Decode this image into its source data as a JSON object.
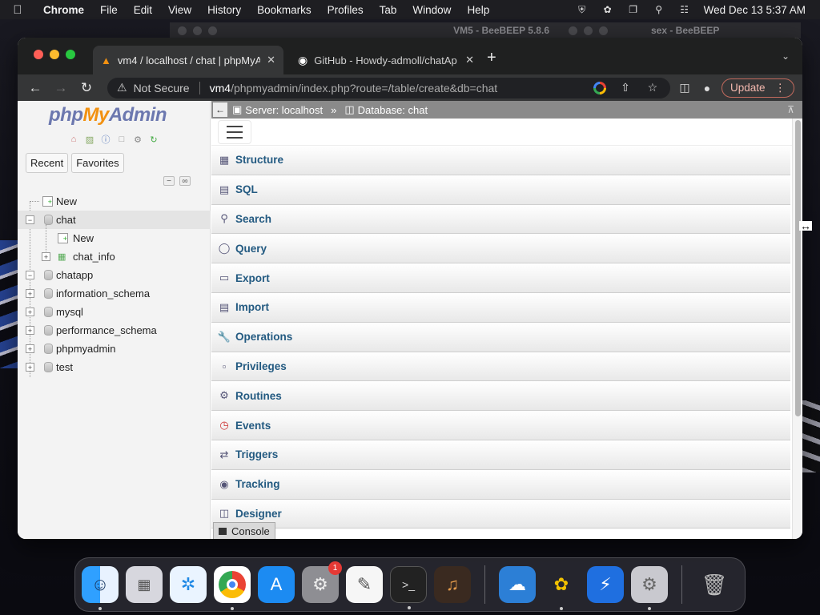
{
  "menubar": {
    "app_name": "Chrome",
    "items": [
      "File",
      "Edit",
      "View",
      "History",
      "Bookmarks",
      "Profiles",
      "Tab",
      "Window",
      "Help"
    ],
    "clock": "Wed Dec 13  5:37 AM"
  },
  "background_windows": [
    {
      "title": "VM5 - BeeBEEP 5.8.6"
    },
    {
      "title": "sex - BeeBEEP"
    }
  ],
  "browser": {
    "tabs": [
      {
        "title": "vm4 / localhost / chat | phpMyA",
        "active": true
      },
      {
        "title": "GitHub - Howdy-admoll/chatAp",
        "active": false
      }
    ],
    "address": {
      "security_label": "Not Secure",
      "host": "vm4",
      "path": "/phpmyadmin/index.php?route=/table/create&db=chat"
    },
    "update_label": "Update"
  },
  "pma": {
    "logo": {
      "php": "php",
      "my": "My",
      "admin": "Admin"
    },
    "side_tabs": [
      "Recent",
      "Favorites"
    ],
    "tree": [
      {
        "label": "New",
        "level": 0,
        "kind": "new"
      },
      {
        "label": "chat",
        "level": 0,
        "kind": "db",
        "expanded": true
      },
      {
        "label": "New",
        "level": 1,
        "kind": "new"
      },
      {
        "label": "chat_info",
        "level": 1,
        "kind": "table"
      },
      {
        "label": "chatapp",
        "level": 0,
        "kind": "db",
        "expanded": true
      },
      {
        "label": "information_schema",
        "level": 0,
        "kind": "db"
      },
      {
        "label": "mysql",
        "level": 0,
        "kind": "db"
      },
      {
        "label": "performance_schema",
        "level": 0,
        "kind": "db"
      },
      {
        "label": "phpmyadmin",
        "level": 0,
        "kind": "db"
      },
      {
        "label": "test",
        "level": 0,
        "kind": "db"
      }
    ],
    "breadcrumb": {
      "server": "Server: localhost",
      "sep": "»",
      "database": "Database: chat"
    },
    "menu": [
      {
        "label": "Structure",
        "icon": "structure-icon"
      },
      {
        "label": "SQL",
        "icon": "sql-icon"
      },
      {
        "label": "Search",
        "icon": "search-icon"
      },
      {
        "label": "Query",
        "icon": "query-icon"
      },
      {
        "label": "Export",
        "icon": "export-icon"
      },
      {
        "label": "Import",
        "icon": "import-icon"
      },
      {
        "label": "Operations",
        "icon": "wrench-icon"
      },
      {
        "label": "Privileges",
        "icon": "privileges-icon"
      },
      {
        "label": "Routines",
        "icon": "routines-icon"
      },
      {
        "label": "Events",
        "icon": "clock-icon"
      },
      {
        "label": "Triggers",
        "icon": "triggers-icon"
      },
      {
        "label": "Tracking",
        "icon": "eye-icon"
      },
      {
        "label": "Designer",
        "icon": "designer-icon"
      }
    ],
    "console_label": "Console"
  },
  "dock": {
    "apps": [
      "Finder",
      "Launchpad",
      "Safari",
      "Chrome",
      "App Store",
      "System Preferences",
      "TextEdit",
      "Terminal",
      "GarageBand",
      "Weather",
      "BeeBEEP",
      "Proton VPN",
      "Settings",
      "Trash"
    ],
    "badge": "1"
  },
  "colors": {
    "pma_link": "#235a81",
    "tab_active": "#353637",
    "tabbar": "#1f2020",
    "update_border": "#c26a5d"
  }
}
